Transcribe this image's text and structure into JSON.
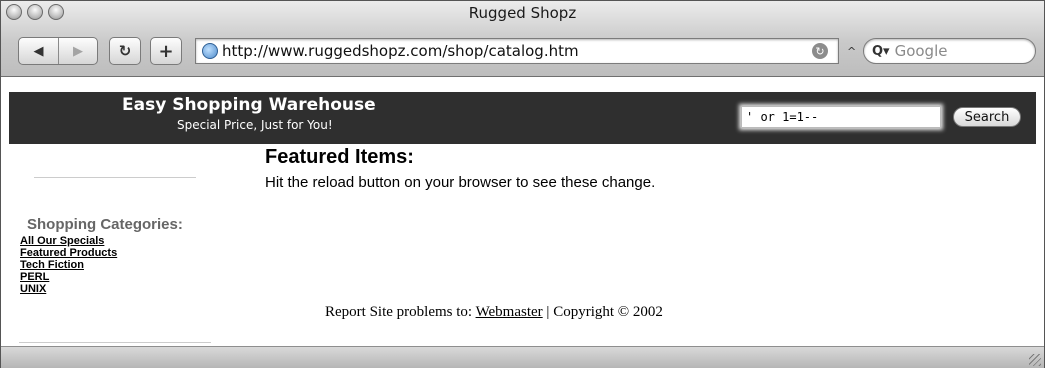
{
  "window": {
    "title": "Rugged Shopz"
  },
  "toolbar": {
    "back_icon": "◀",
    "forward_icon": "▶",
    "reload_icon": "↻",
    "add_icon": "+",
    "url": "http://www.ruggedshopz.com/shop/catalog.htm",
    "search_placeholder": "Google",
    "search_icon": "Q▾",
    "caret_icon": "^"
  },
  "store": {
    "title": "Easy Shopping Warehouse",
    "tagline": "Special Price, Just for You!",
    "search_value": "' or 1=1--",
    "search_button": "Search"
  },
  "featured": {
    "heading": "Featured Items:",
    "note": "Hit the reload button on your browser to see these change."
  },
  "categories": {
    "heading": "Shopping Categories:",
    "items": [
      "All Our Specials",
      "Featured Products",
      "Tech Fiction",
      "PERL",
      "UNIX"
    ]
  },
  "footer": {
    "prefix": "Report Site problems to:",
    "link": "Webmaster",
    "separator": "|",
    "copyright": "Copyright © 2002"
  }
}
